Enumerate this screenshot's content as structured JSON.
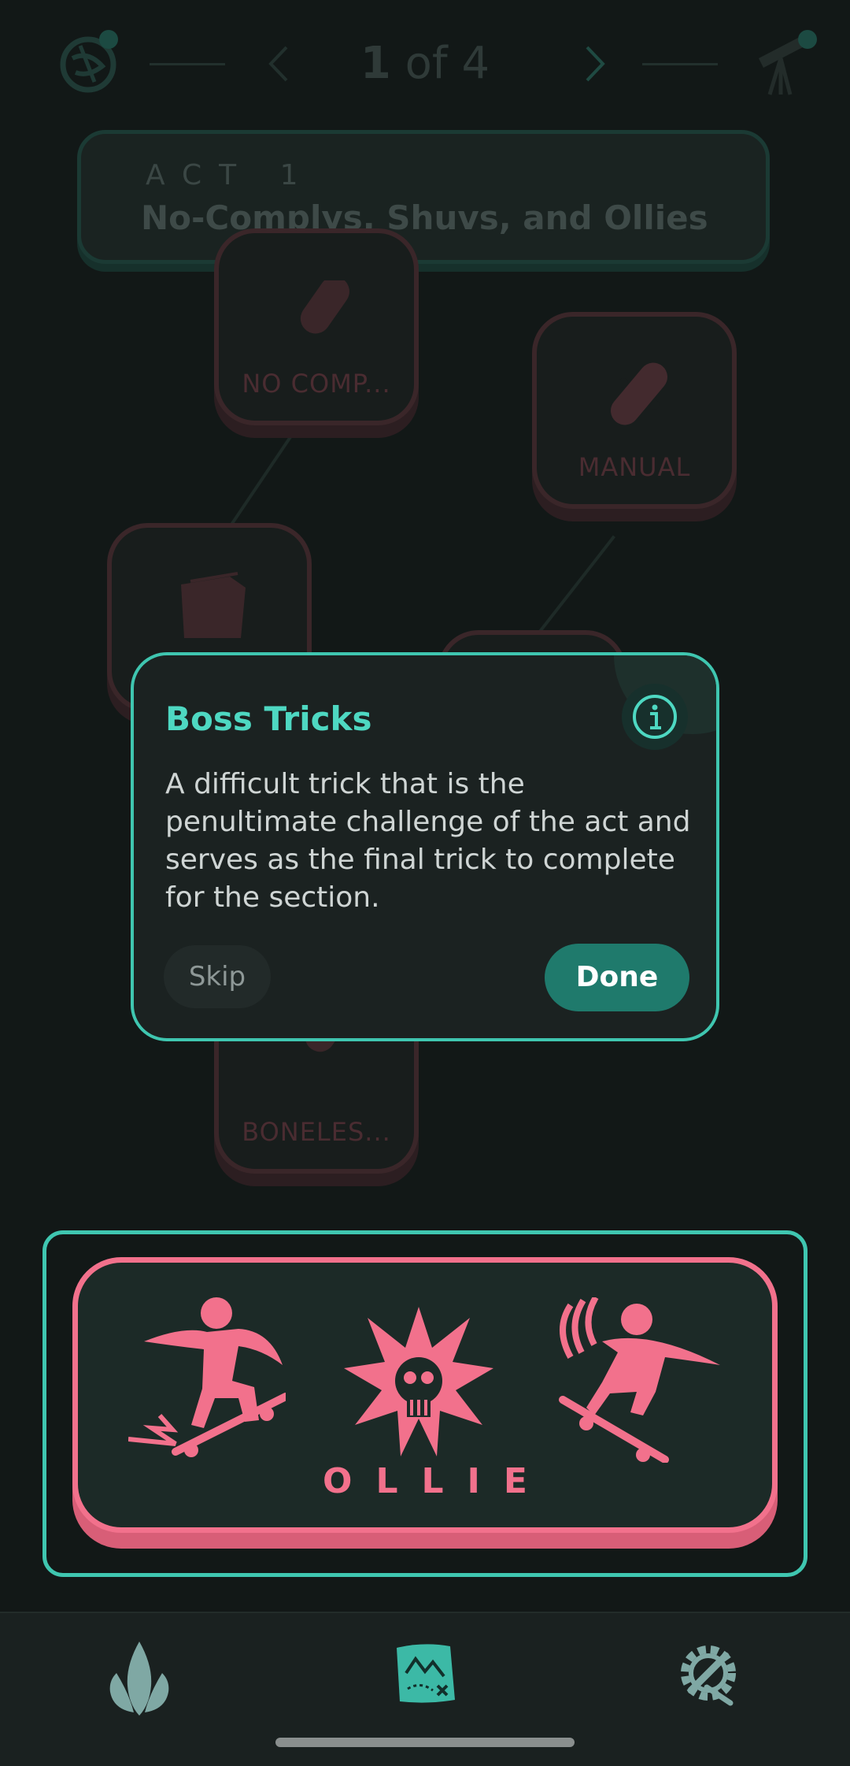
{
  "header": {
    "pager_current": "1",
    "pager_of": "of",
    "pager_total": "4",
    "left_icon": "nebula-icon",
    "right_icon": "telescope-icon"
  },
  "act": {
    "label": "ACT 1",
    "title": "No-Complys, Shuvs, and Ollies"
  },
  "nodes": [
    {
      "label": "NO COMP...",
      "icon": "skateboard-icon"
    },
    {
      "label": "MANUAL",
      "icon": "skateboard-icon"
    },
    {
      "label": "",
      "icon": "folder-icon"
    },
    {
      "label": "BONELES...",
      "icon": "skateboard-icon"
    }
  ],
  "modal": {
    "title": "Boss Tricks",
    "body": "A difficult trick that is the penultimate challenge of the act and serves as the final trick to complete for the section.",
    "skip_label": "Skip",
    "done_label": "Done",
    "info_icon": "info-icon"
  },
  "boss": {
    "label": "OLLIE",
    "icons": [
      "skater-pop-icon",
      "skull-burst-icon",
      "skater-landing-icon"
    ]
  },
  "bottom_nav": {
    "items": [
      "flame-icon",
      "treasure-map-icon",
      "gear-wrench-icon"
    ]
  },
  "colors": {
    "accent": "#3fc6b0",
    "boss": "#f2718c",
    "background": "#121817"
  }
}
